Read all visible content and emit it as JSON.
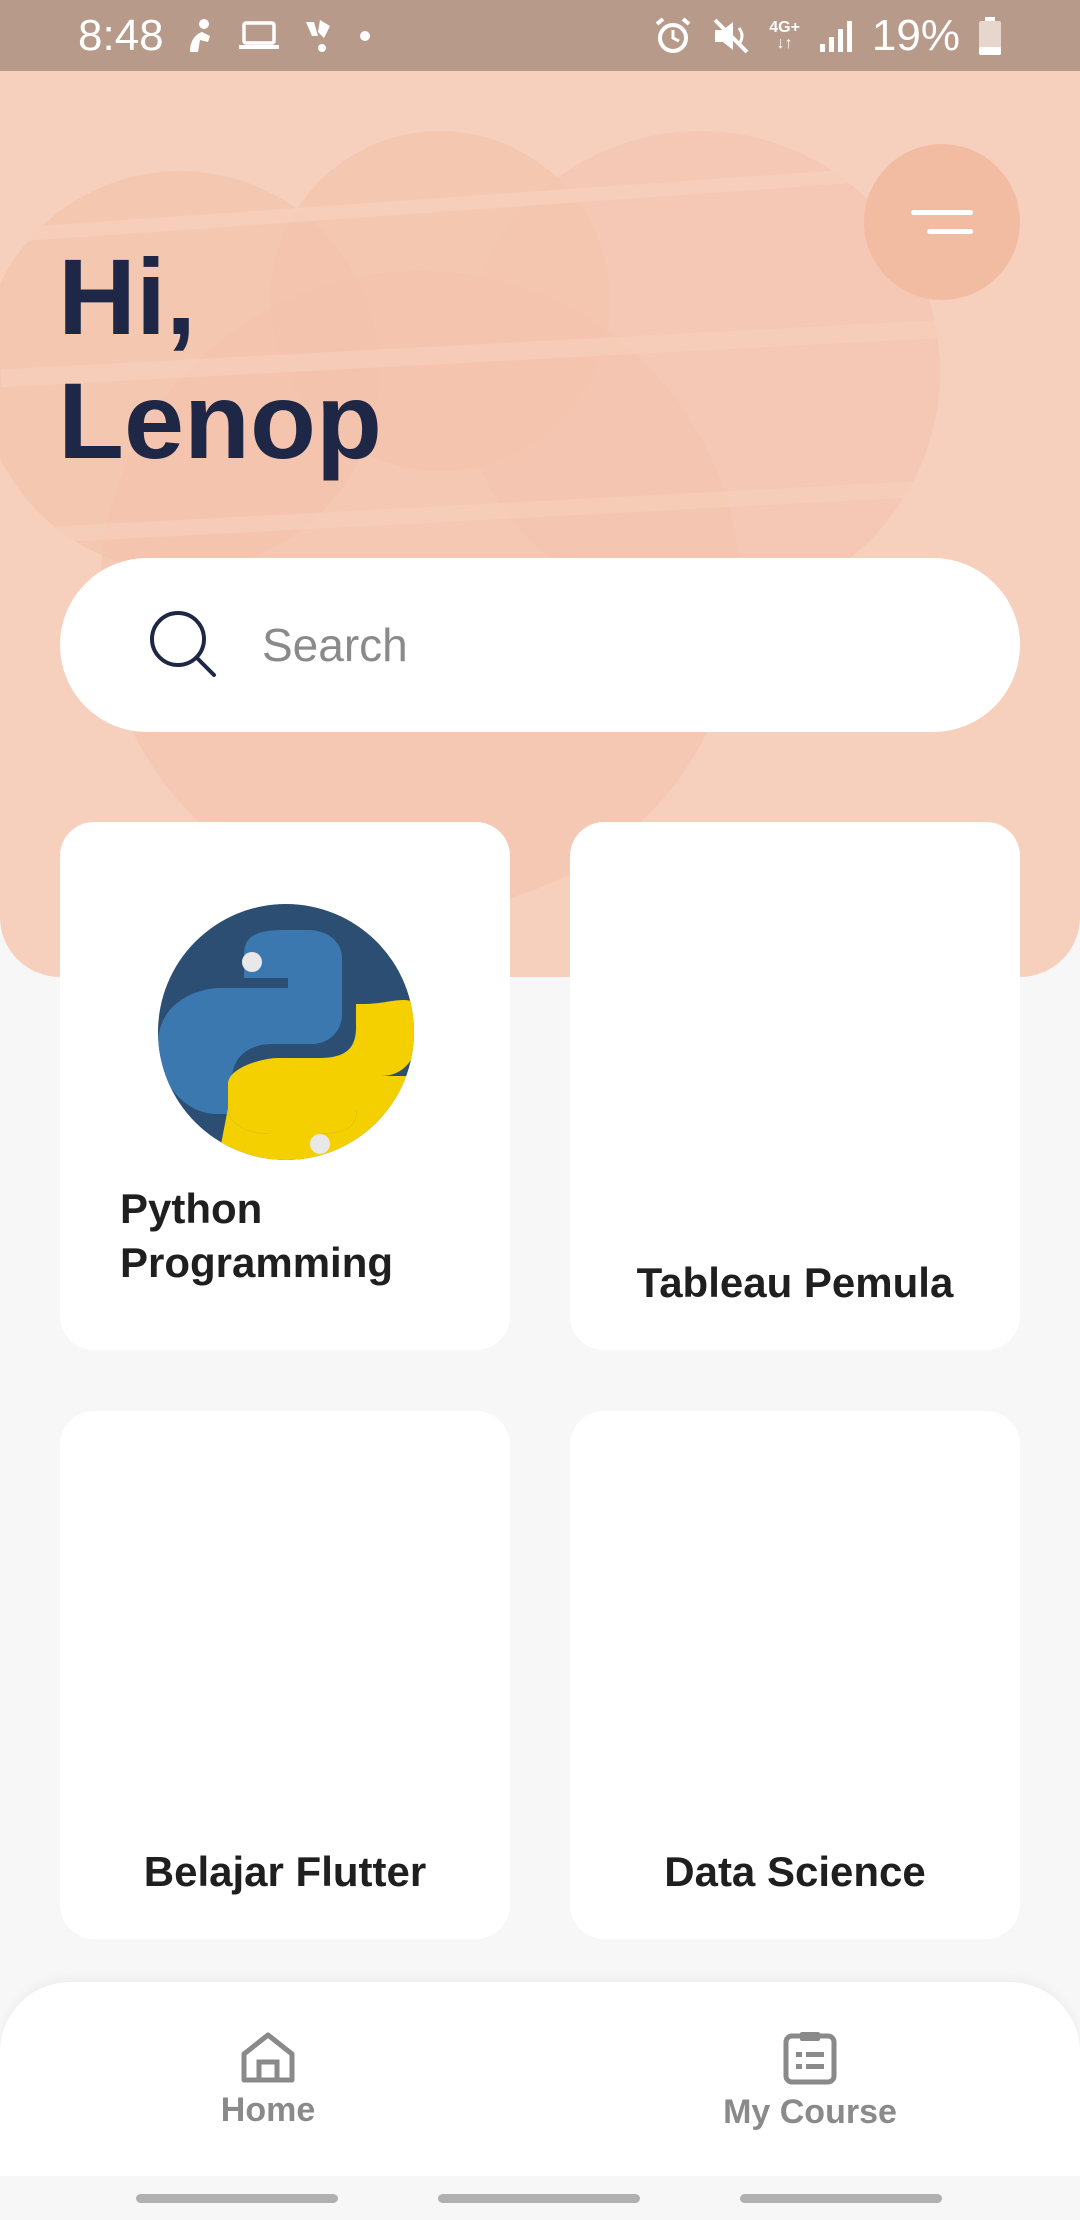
{
  "status_bar": {
    "time": "8:48",
    "network": "4G+",
    "battery": "19%",
    "icons": [
      "fitness-icon",
      "laptop-icon",
      "app-notification-icon",
      "dot-icon",
      "alarm-icon",
      "mute-icon",
      "signal-icon",
      "battery-icon"
    ]
  },
  "header": {
    "greeting_line1": "Hi,",
    "greeting_line2": "Lenop",
    "menu_icon": "menu-icon"
  },
  "search": {
    "placeholder": "Search",
    "value": ""
  },
  "courses": [
    {
      "title": "Python Programming",
      "icon": "python-logo-icon"
    },
    {
      "title": "Tableau Pemula",
      "icon": ""
    },
    {
      "title": "Belajar Flutter",
      "icon": ""
    },
    {
      "title": "Data Science",
      "icon": ""
    }
  ],
  "bottom_nav": {
    "items": [
      {
        "label": "Home",
        "icon": "home-icon"
      },
      {
        "label": "My Course",
        "icon": "clipboard-icon"
      }
    ]
  },
  "colors": {
    "hero_bg": "#f6d0bd",
    "menu_circle": "#f2bca3",
    "greeting_text": "#1e2746",
    "status_bar": "#b89a8a",
    "python_blue": "#3b78b0",
    "python_yellow": "#f5d000",
    "python_circle": "#2b4e72"
  }
}
